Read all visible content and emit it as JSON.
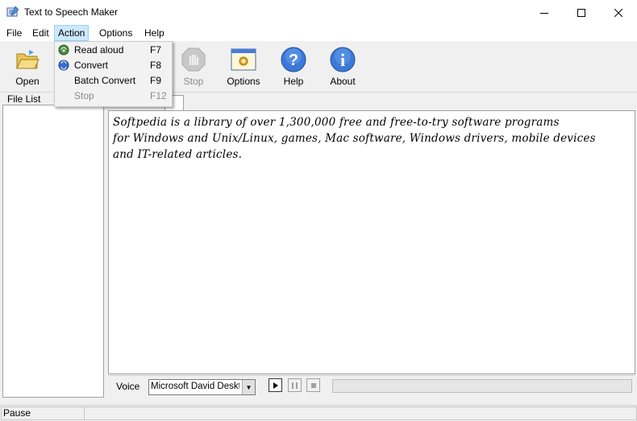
{
  "window": {
    "title": "Text to Speech Maker"
  },
  "menubar": {
    "file": "File",
    "edit": "Edit",
    "action": "Action",
    "options": "Options",
    "help": "Help"
  },
  "toolbar": {
    "open": "Open",
    "stop": "Stop",
    "options": "Options",
    "help": "Help",
    "about": "About"
  },
  "action_menu": {
    "items": [
      {
        "label": "Read aloud",
        "shortcut": "F7"
      },
      {
        "label": "Convert",
        "shortcut": "F8"
      },
      {
        "label": "Batch Convert",
        "shortcut": "F9"
      },
      {
        "label": "Stop",
        "shortcut": "F12"
      }
    ]
  },
  "file_list": {
    "label": "File List"
  },
  "editor": {
    "tab_label": "le",
    "text": "Softpedia is a library of over 1,300,000 free and free-to-try software programs\nfor Windows and Unix/Linux, games, Mac software, Windows drivers, mobile devices\nand IT-related articles."
  },
  "voice": {
    "label": "Voice",
    "selected": "Microsoft David Desktop"
  },
  "status": {
    "text": "Pause"
  },
  "colors": {
    "menu_highlight": "#cce8ff",
    "help_blue": "#2f6fd6"
  }
}
